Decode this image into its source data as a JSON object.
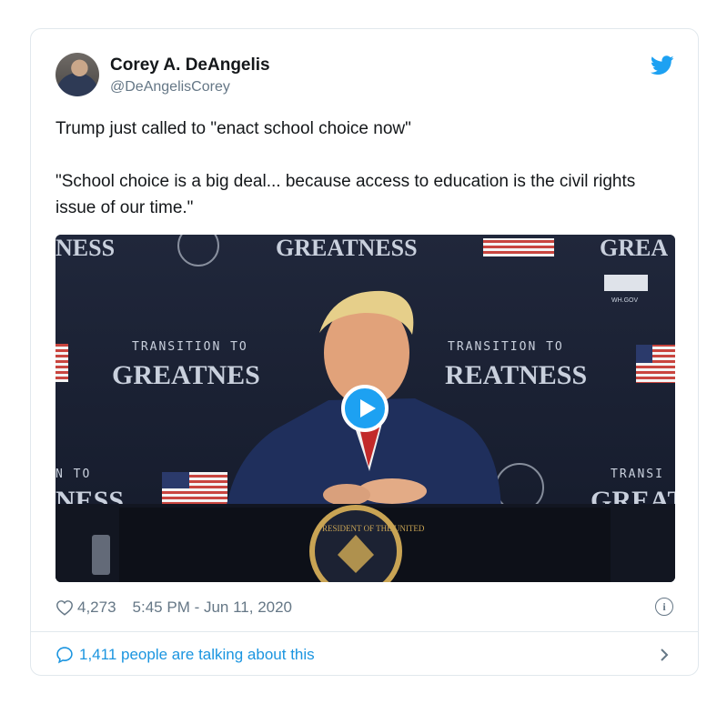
{
  "tweet": {
    "author_name": "Corey A. DeAngelis",
    "author_handle": "@DeAngelisCorey",
    "text": "Trump just called to \"enact school choice now\"\n\n\"School choice is a big deal... because access to education is the civil rights issue of our time.\"",
    "likes": "4,273",
    "timestamp": "5:45 PM - Jun 11, 2020",
    "talking": "1,411 people are talking about this"
  },
  "media": {
    "backdrop_text": {
      "top_left": "NESS",
      "top_center": "GREATNESS",
      "top_right": "GREA",
      "wh_gov": "WH.GOV",
      "transition_left": "TRANSITION TO",
      "greatness_left": "GREATNES",
      "transition_right": "TRANSITION TO",
      "greatness_right": "REATNESS",
      "lower_left_small": "N TO",
      "lower_left": "NESS",
      "lower_right_small": "TRANSI",
      "lower_right": "GREAT",
      "seal_text": "PRESIDENT OF THE UNITED"
    }
  },
  "icons": {
    "twitter": "twitter-bird-icon",
    "heart": "heart-icon",
    "info": "info-icon",
    "comment": "comment-bubble-icon",
    "chevron": "chevron-right-icon",
    "play": "play-icon"
  },
  "colors": {
    "twitter_blue": "#1da1f2",
    "link_blue": "#1b95e0",
    "muted": "#657786",
    "border": "#e1e8ed"
  }
}
